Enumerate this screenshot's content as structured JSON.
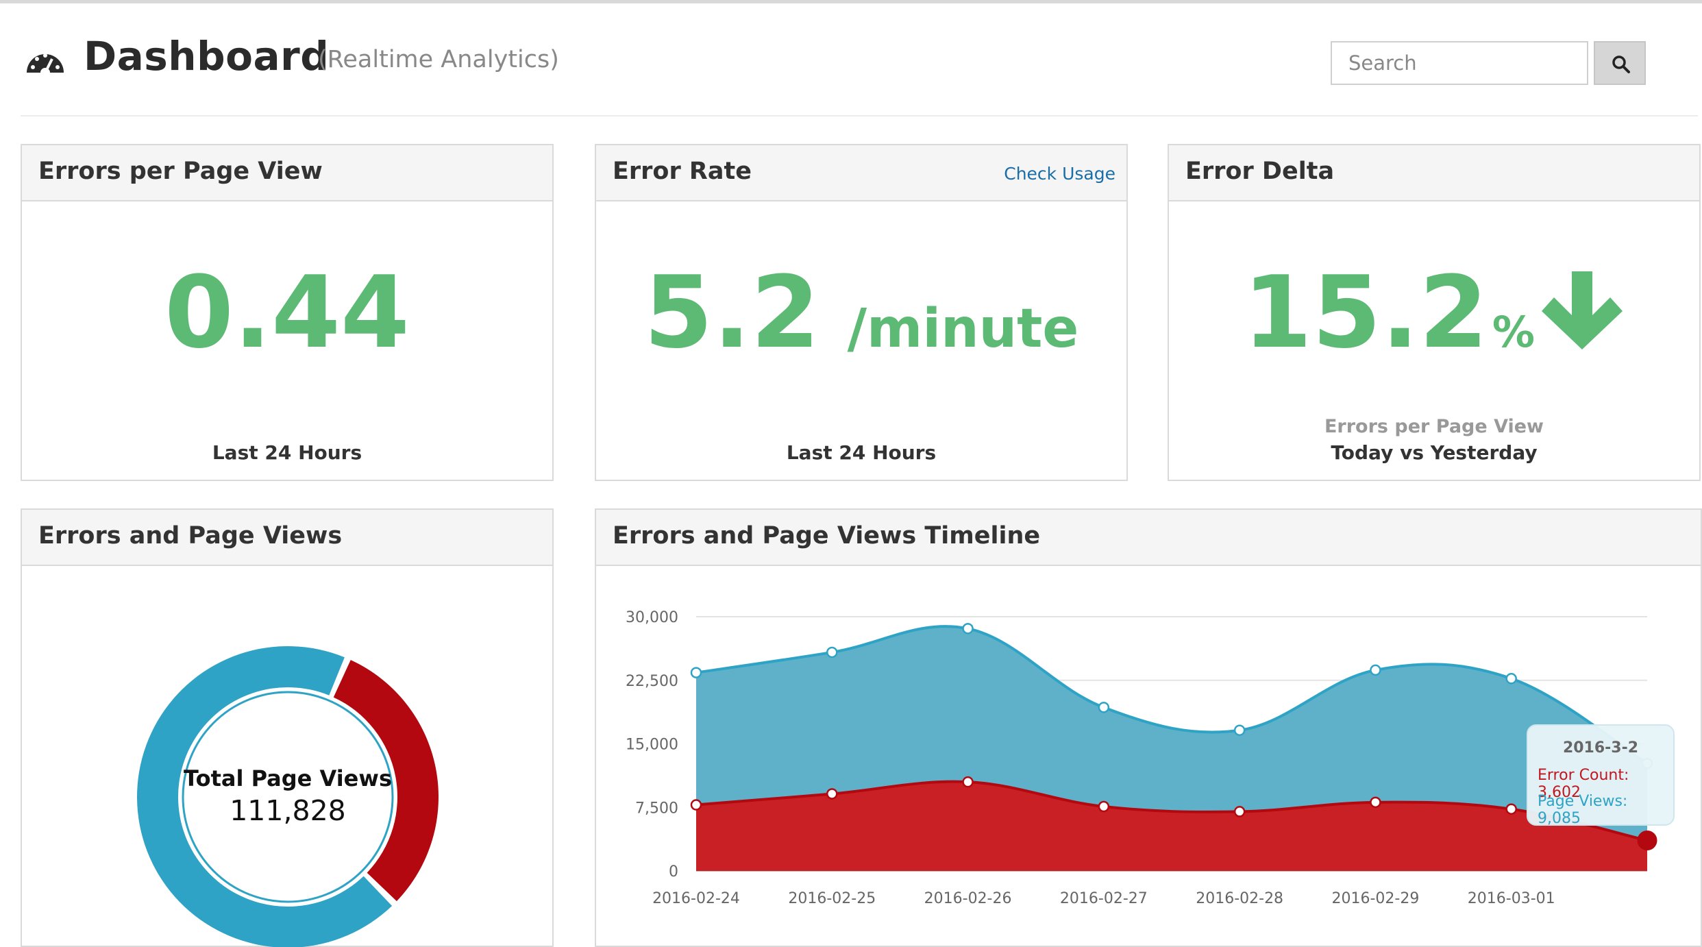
{
  "header": {
    "title": "Dashboard",
    "subtitle": "(Realtime Analytics)",
    "search_placeholder": "Search",
    "icons": {
      "dashboard": "tachometer-icon",
      "search": "search-icon"
    }
  },
  "cards": {
    "errors_per_page_view": {
      "title": "Errors per Page View",
      "value": "0.44",
      "caption": "Last 24 Hours"
    },
    "error_rate": {
      "title": "Error Rate",
      "link": "Check Usage",
      "value": "5.2",
      "unit": "/minute",
      "caption": "Last 24 Hours"
    },
    "error_delta": {
      "title": "Error Delta",
      "value": "15.2",
      "unit": "%",
      "direction_icon": "arrow-down-icon",
      "caption_top": "Errors per Page View",
      "caption": "Today vs Yesterday"
    },
    "errors_and_page_views": {
      "title": "Errors and Page Views",
      "center_label": "Total Page Views",
      "center_value": "111,828"
    },
    "timeline": {
      "title": "Errors and Page Views Timeline",
      "tooltip": {
        "date": "2016-3-2",
        "error_line": "Error Count: 3,602",
        "pageview_line": "Page Views: 9,085"
      }
    }
  },
  "colors": {
    "green": "#5cba74",
    "page_views": "#2ea3c5",
    "errors": "#b3080f",
    "link": "#1a6ea8"
  },
  "chart_data": [
    {
      "type": "pie",
      "title": "",
      "categories": [
        "Page Views",
        "Errors"
      ],
      "values": [
        0.69,
        0.31
      ],
      "donut": true
    },
    {
      "type": "area",
      "title": "",
      "x": [
        "2016-02-24",
        "2016-02-25",
        "2016-02-26",
        "2016-02-27",
        "2016-02-28",
        "2016-02-29",
        "2016-03-01",
        "2016-03-02"
      ],
      "x_tick_labels": [
        "2016-02-24",
        "2016-02-25",
        "2016-02-26",
        "2016-02-27",
        "2016-02-28",
        "2016-02-29",
        "2016-03-01"
      ],
      "series": [
        {
          "name": "Page Views",
          "values": [
            23400,
            25800,
            28600,
            19300,
            16600,
            23700,
            22700,
            12687
          ]
        },
        {
          "name": "Error Count",
          "values": [
            7800,
            9100,
            10500,
            7600,
            7000,
            8100,
            7300,
            3602
          ]
        }
      ],
      "stacked": true,
      "ylim": [
        0,
        30000
      ],
      "y_ticks": [
        "0",
        "7,500",
        "15,000",
        "22,500",
        "30,000"
      ],
      "grid": true
    }
  ]
}
